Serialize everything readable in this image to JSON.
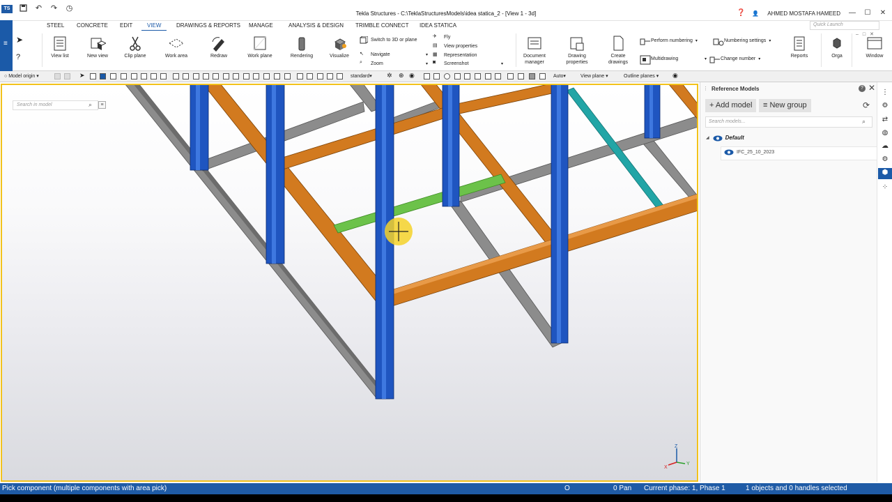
{
  "window": {
    "title": "Tekla Structures - C:\\TeklaStructuresModels\\idea statica_2  - [View 1 - 3d]",
    "user": "AHMED MOSTAFA HAMEED",
    "logo": "TS"
  },
  "ribbon_tabs": [
    "STEEL",
    "CONCRETE",
    "EDIT",
    "VIEW",
    "DRAWINGS & REPORTS",
    "MANAGE",
    "ANALYSIS & DESIGN",
    "TRIMBLE CONNECT",
    "IDEA STATICA"
  ],
  "active_tab": "VIEW",
  "quick_launch_placeholder": "Quick Launch",
  "ribbon": {
    "view_list": "View list",
    "new_view": "New view",
    "clip_plane": "Clip plane",
    "work_area": "Work area",
    "redraw": "Redraw",
    "work_plane": "Work plane",
    "rendering": "Rendering",
    "visualize": "Visualize",
    "switch_3d": "Switch to 3D or plane",
    "navigate": "Navigate",
    "zoom": "Zoom",
    "fly": "Fly",
    "view_properties": "View properties",
    "representation": "Representation",
    "screenshot": "Screenshot",
    "document_manager_1": "Document",
    "document_manager_2": "manager",
    "drawing_properties_1": "Drawing",
    "drawing_properties_2": "properties",
    "create_drawings_1": "Create",
    "create_drawings_2": "drawings",
    "perform_numbering": "Perform numbering",
    "multidrawing": "Multidrawing",
    "numbering_settings": "Numbering settings",
    "change_number": "Change number",
    "reports": "Reports",
    "orga": "Orga",
    "window": "Window"
  },
  "toolbar": {
    "model_origin": "Model origin",
    "standard": "standard",
    "auto": "Auto",
    "view_plane": "View plane",
    "outline_planes": "Outline planes"
  },
  "viewport": {
    "search_placeholder": "Search in model",
    "axis_labels": {
      "z": "Z",
      "y": "Y",
      "x": "X"
    }
  },
  "reference_models": {
    "title": "Reference Models",
    "add_model": "+ Add model",
    "new_group": "New group",
    "search_placeholder": "Search models...",
    "groups": [
      {
        "name": "Default",
        "items": [
          "IFC_25_10_2023"
        ]
      }
    ]
  },
  "status": {
    "prompt": "Pick component (multiple components with area pick)",
    "o_flag": "O",
    "pan": "0 Pan",
    "phase": "Current phase: 1, Phase 1",
    "selection": "1 objects and 0 handles selected"
  },
  "colors": {
    "accent": "#1b5aa8",
    "column": "#1f55c0",
    "beam_orange": "#d27a1f",
    "beam_gray": "#8a8a8a",
    "beam_green": "#6cc24a",
    "beam_teal": "#22a5a6",
    "cursor": "#f4d22a",
    "viewport_border": "#f2c21b"
  }
}
